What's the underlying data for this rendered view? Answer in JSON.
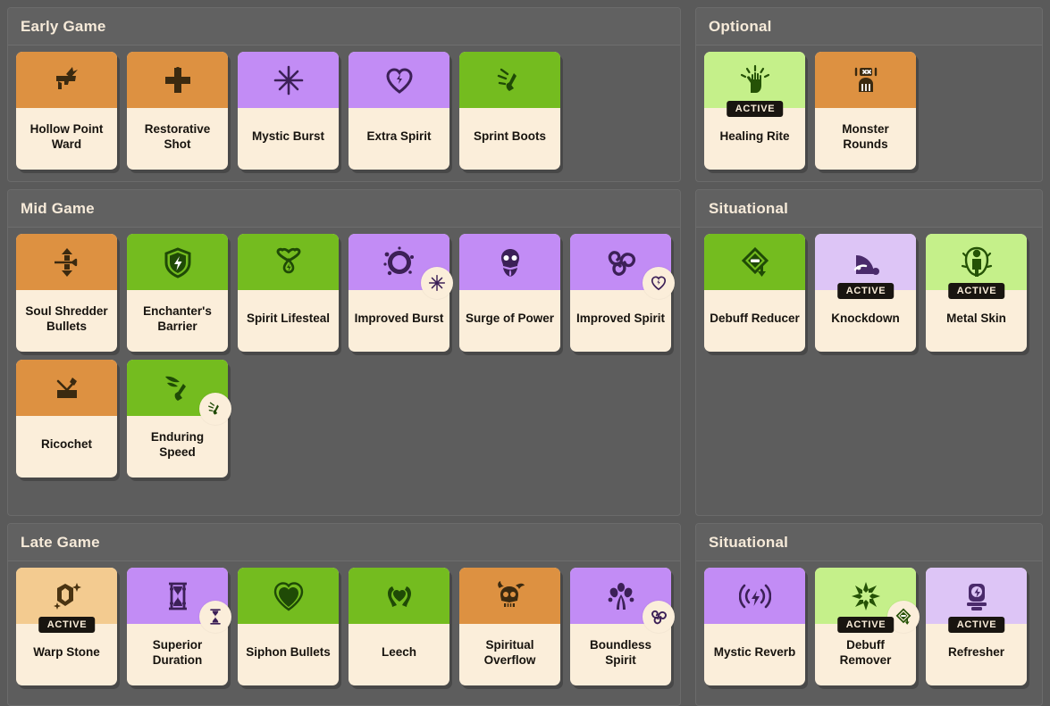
{
  "theme": {
    "background": "#5a5a5a",
    "panel_bg": "#5d5d5d",
    "panel_header_bg": "#616161",
    "card_body": "#fbeeda",
    "title_color": "#f6ead9",
    "orange": "#dd9141",
    "light_orange": "#f3cb90",
    "purple": "#c28cf5",
    "light_purple": "#ddc5f6",
    "green": "#74bc1f",
    "light_green": "#c5f08a",
    "active_badge_bg": "#191510"
  },
  "active_label": "ACTIVE",
  "panels": [
    {
      "title": "Early Game",
      "column": "left",
      "items": [
        {
          "name": "Hollow Point Ward",
          "rarity": "orange",
          "icon": "pistol-lightning-icon",
          "active": false,
          "component": null
        },
        {
          "name": "Restorative Shot",
          "rarity": "orange",
          "icon": "bullet-cross-icon",
          "active": false,
          "component": null
        },
        {
          "name": "Mystic Burst",
          "rarity": "purple",
          "icon": "starburst-icon",
          "active": false,
          "component": null
        },
        {
          "name": "Extra Spirit",
          "rarity": "purple",
          "icon": "heart-bolt-icon",
          "active": false,
          "component": null
        },
        {
          "name": "Sprint Boots",
          "rarity": "green",
          "icon": "running-foot-icon",
          "active": false,
          "component": null
        }
      ]
    },
    {
      "title": "Optional",
      "column": "right",
      "items": [
        {
          "name": "Healing Rite",
          "rarity": "light_green",
          "icon": "healing-hand-icon",
          "active": true,
          "component": null
        },
        {
          "name": "Monster Rounds",
          "rarity": "orange",
          "icon": "monster-bot-icon",
          "active": false,
          "component": null
        }
      ]
    },
    {
      "title": "Mid Game",
      "column": "left",
      "items": [
        {
          "name": "Soul Shredder Bullets",
          "rarity": "orange",
          "icon": "bullet-arrows-icon",
          "active": false,
          "component": null
        },
        {
          "name": "Enchanter's Barrier",
          "rarity": "green",
          "icon": "shield-bolt-icon",
          "active": false,
          "component": null
        },
        {
          "name": "Spirit Lifesteal",
          "rarity": "green",
          "icon": "heart-drip-icon",
          "active": false,
          "component": null
        },
        {
          "name": "Improved Burst",
          "rarity": "purple",
          "icon": "splash-burst-icon",
          "active": false,
          "component": "starburst-icon"
        },
        {
          "name": "Surge of Power",
          "rarity": "purple",
          "icon": "spirit-skull-icon",
          "active": false,
          "component": null
        },
        {
          "name": "Improved Spirit",
          "rarity": "purple",
          "icon": "triple-swirl-icon",
          "active": false,
          "component": "heart-bolt-icon"
        },
        {
          "name": "Ricochet",
          "rarity": "orange",
          "icon": "ricochet-bounce-icon",
          "active": false,
          "component": null
        },
        {
          "name": "Enduring Speed",
          "rarity": "green",
          "icon": "winged-foot-icon",
          "active": false,
          "component": "running-foot-icon"
        }
      ]
    },
    {
      "title": "Situational",
      "column": "right",
      "items": [
        {
          "name": "Debuff Reducer",
          "rarity": "green",
          "icon": "minus-diamond-down-icon",
          "active": false,
          "component": null
        },
        {
          "name": "Knockdown",
          "rarity": "light_purple",
          "icon": "knockdown-figure-icon",
          "active": true,
          "component": null
        },
        {
          "name": "Metal Skin",
          "rarity": "light_green",
          "icon": "armored-figure-icon",
          "active": true,
          "component": null
        }
      ]
    },
    {
      "title": "Late Game",
      "column": "left",
      "items": [
        {
          "name": "Warp Stone",
          "rarity": "light_orange",
          "icon": "crystal-sparkle-icon",
          "active": true,
          "component": null
        },
        {
          "name": "Superior Duration",
          "rarity": "purple",
          "icon": "hourglass-ornate-icon",
          "active": false,
          "component": "hourglass-icon"
        },
        {
          "name": "Siphon Bullets",
          "rarity": "green",
          "icon": "heart-rings-icon",
          "active": false,
          "component": null
        },
        {
          "name": "Leech",
          "rarity": "green",
          "icon": "hands-heart-icon",
          "active": false,
          "component": null
        },
        {
          "name": "Spiritual Overflow",
          "rarity": "orange",
          "icon": "flaming-skull-icon",
          "active": false,
          "component": null
        },
        {
          "name": "Boundless Spirit",
          "rarity": "purple",
          "icon": "spirit-bloom-icon",
          "active": false,
          "component": "triple-swirl-icon"
        }
      ]
    },
    {
      "title": "Situational",
      "column": "right",
      "items": [
        {
          "name": "Mystic Reverb",
          "rarity": "purple",
          "icon": "sound-wave-bolt-icon",
          "active": false,
          "component": null
        },
        {
          "name": "Debuff Remover",
          "rarity": "light_green",
          "icon": "burst-ring-icon",
          "active": true,
          "component": "minus-diamond-down-icon"
        },
        {
          "name": "Refresher",
          "rarity": "light_purple",
          "icon": "battery-bolt-icon",
          "active": true,
          "component": null
        }
      ]
    }
  ]
}
